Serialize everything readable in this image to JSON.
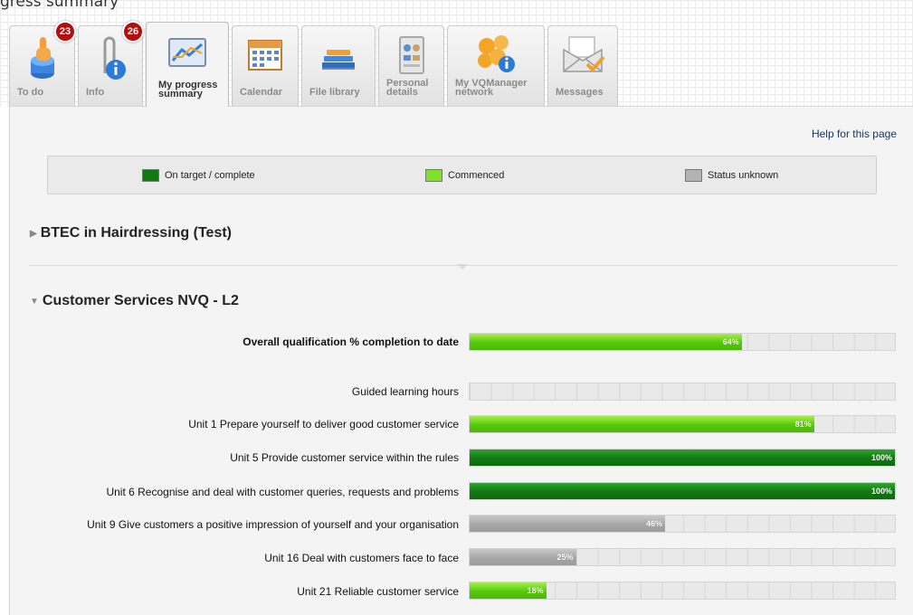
{
  "page": {
    "heading": "gress summary"
  },
  "tabs": [
    {
      "label": "To do",
      "icon": "finger-icon",
      "badge": "23"
    },
    {
      "label": "Info",
      "icon": "info-clip-icon",
      "badge": "26"
    },
    {
      "label": "My progress\nsummary",
      "icon": "chart-icon",
      "active": true
    },
    {
      "label": "Calendar",
      "icon": "calendar-icon"
    },
    {
      "label": "File library",
      "icon": "books-icon"
    },
    {
      "label": "Personal\ndetails",
      "icon": "contacts-icon"
    },
    {
      "label": "My VQManager\nnetwork",
      "icon": "network-icon"
    },
    {
      "label": "Messages",
      "icon": "envelope-icon"
    }
  ],
  "help_link": "Help for this page",
  "legend": [
    {
      "label": "On target / complete",
      "color": "#127812"
    },
    {
      "label": "Commenced",
      "color": "#7fe02a"
    },
    {
      "label": "Status unknown",
      "color": "#b3b3b3"
    }
  ],
  "sections": {
    "collapsed": {
      "title": "BTEC in Hairdressing (Test)"
    },
    "expanded": {
      "title": "Customer Services NVQ - L2"
    }
  },
  "progress_rows": [
    {
      "label": "Overall qualification % completion to date",
      "percent": 64,
      "percent_text": "64%",
      "status": "commenced",
      "bold": true
    },
    {
      "label": "Guided learning hours",
      "percent": 0,
      "percent_text": "",
      "status": "none"
    },
    {
      "label": "Unit 1 Prepare yourself to deliver good customer service",
      "percent": 81,
      "percent_text": "81%",
      "status": "commenced"
    },
    {
      "label": "Unit 5 Provide customer service within the rules",
      "percent": 100,
      "percent_text": "100%",
      "status": "complete"
    },
    {
      "label": "Unit 6 Recognise and deal with customer queries, requests and problems",
      "percent": 100,
      "percent_text": "100%",
      "status": "complete"
    },
    {
      "label": "Unit 9 Give customers a positive impression of yourself and your organisation",
      "percent": 46,
      "percent_text": "46%",
      "status": "unknown"
    },
    {
      "label": "Unit 16 Deal with customers face to face",
      "percent": 25,
      "percent_text": "25%",
      "status": "unknown"
    },
    {
      "label": "Unit 21 Reliable customer service",
      "percent": 18,
      "percent_text": "18%",
      "status": "commenced"
    }
  ]
}
